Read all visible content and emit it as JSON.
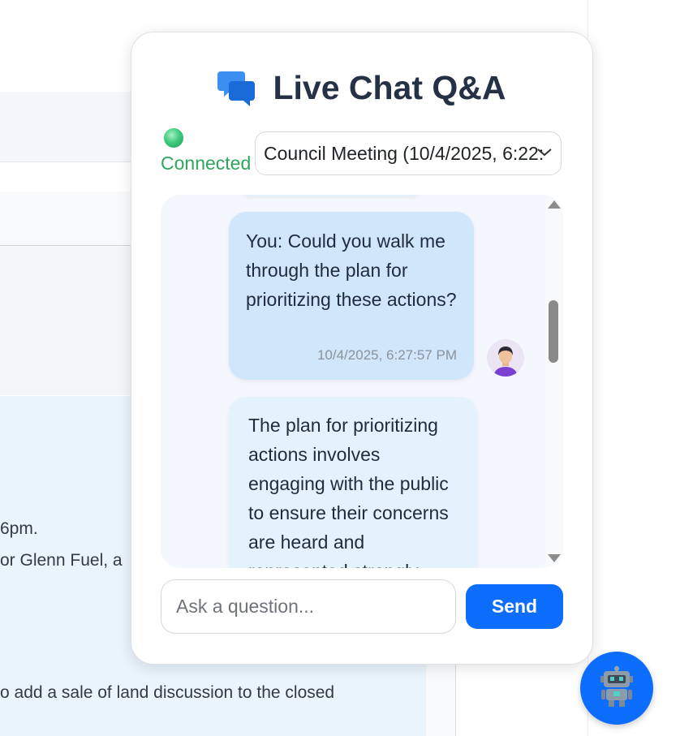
{
  "background": {
    "text_lines": [
      " 6pm.",
      "or Glenn Fuel, a",
      "o add a sale of land discussion to the closed"
    ]
  },
  "chat": {
    "title": "Live Chat Q&A",
    "title_icon": "speech-bubbles-icon",
    "status_label": "Connected",
    "status_color": "#2ea65b",
    "session_selected": "Council Meeting (10/4/2025, 6:22:",
    "messages": [
      {
        "role": "user",
        "text": "You: Could you walk me through the plan for prioritizing these actions?",
        "time": "10/4/2025, 6:27:57 PM",
        "avatar_icon": "user-avatar-icon"
      },
      {
        "role": "assistant",
        "text": "The plan for prioritizing actions involves engaging with the public to ensure their concerns are heard and represented strongly."
      }
    ],
    "input_placeholder": "Ask a question...",
    "send_label": "Send",
    "accent_color": "#0d6efd",
    "launcher_icon": "robot-icon"
  }
}
